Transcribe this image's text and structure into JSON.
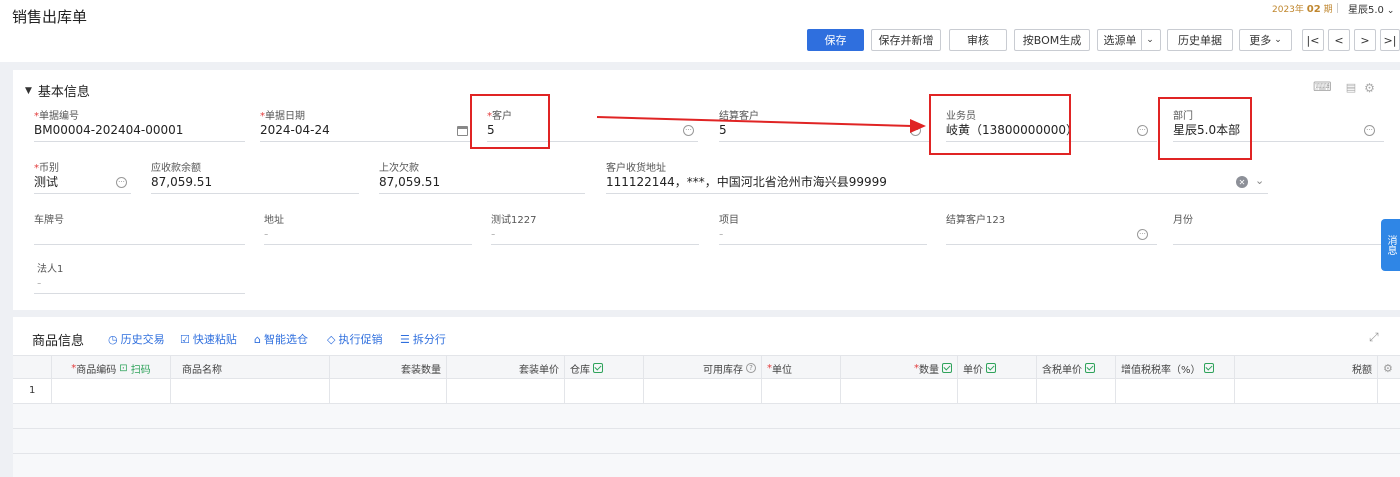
{
  "header": {
    "title": "销售出库单",
    "period_year": "2023年",
    "period_num": "02",
    "period_suffix": "期",
    "account": "星辰5.0"
  },
  "toolbar": {
    "save": "保存",
    "save_new": "保存并新增",
    "audit": "审核",
    "bom": "按BOM生成",
    "source": "选源单",
    "history": "历史单据",
    "more": "更多"
  },
  "basic": {
    "title": "基本信息",
    "fields": {
      "doc_no": {
        "label": "单据编号",
        "value": "BM00004-202404-00001"
      },
      "doc_date": {
        "label": "单据日期",
        "value": "2024-04-24"
      },
      "customer": {
        "label": "客户",
        "value": "5"
      },
      "settle_customer": {
        "label": "结算客户",
        "value": "5"
      },
      "salesman": {
        "label": "业务员",
        "value": "岐黄（13800000000）"
      },
      "dept": {
        "label": "部门",
        "value": "星辰5.0本部"
      },
      "currency": {
        "label": "币别",
        "value": "测试"
      },
      "receivable": {
        "label": "应收款余额",
        "value": "87,059.51"
      },
      "last_debt": {
        "label": "上次欠款",
        "value": "87,059.51"
      },
      "address": {
        "label": "客户收货地址",
        "value": "111122144，***，中国河北省沧州市海兴县99999"
      },
      "plate": {
        "label": "车牌号",
        "value": ""
      },
      "addr": {
        "label": "地址",
        "value": "-"
      },
      "test1227": {
        "label": "测试1227",
        "value": "-"
      },
      "project": {
        "label": "项目",
        "value": "-"
      },
      "settle123": {
        "label": "结算客户123",
        "value": ""
      },
      "month": {
        "label": "月份",
        "value": ""
      },
      "legal": {
        "label": "法人1",
        "value": "-"
      }
    }
  },
  "goods": {
    "title": "商品信息",
    "tools": [
      "历史交易",
      "快速粘贴",
      "智能选仓",
      "执行促销",
      "拆分行"
    ],
    "columns": {
      "code": "商品编码",
      "scan": "扫码",
      "name": "商品名称",
      "set_qty": "套装数量",
      "set_price": "套装单价",
      "warehouse": "仓库",
      "stock": "可用库存",
      "unit": "单位",
      "qty": "数量",
      "price": "单价",
      "tax_price": "含税单价",
      "vat": "增值税税率（%）",
      "tax": "税额"
    },
    "row1": "1"
  },
  "side_tab": "消息"
}
